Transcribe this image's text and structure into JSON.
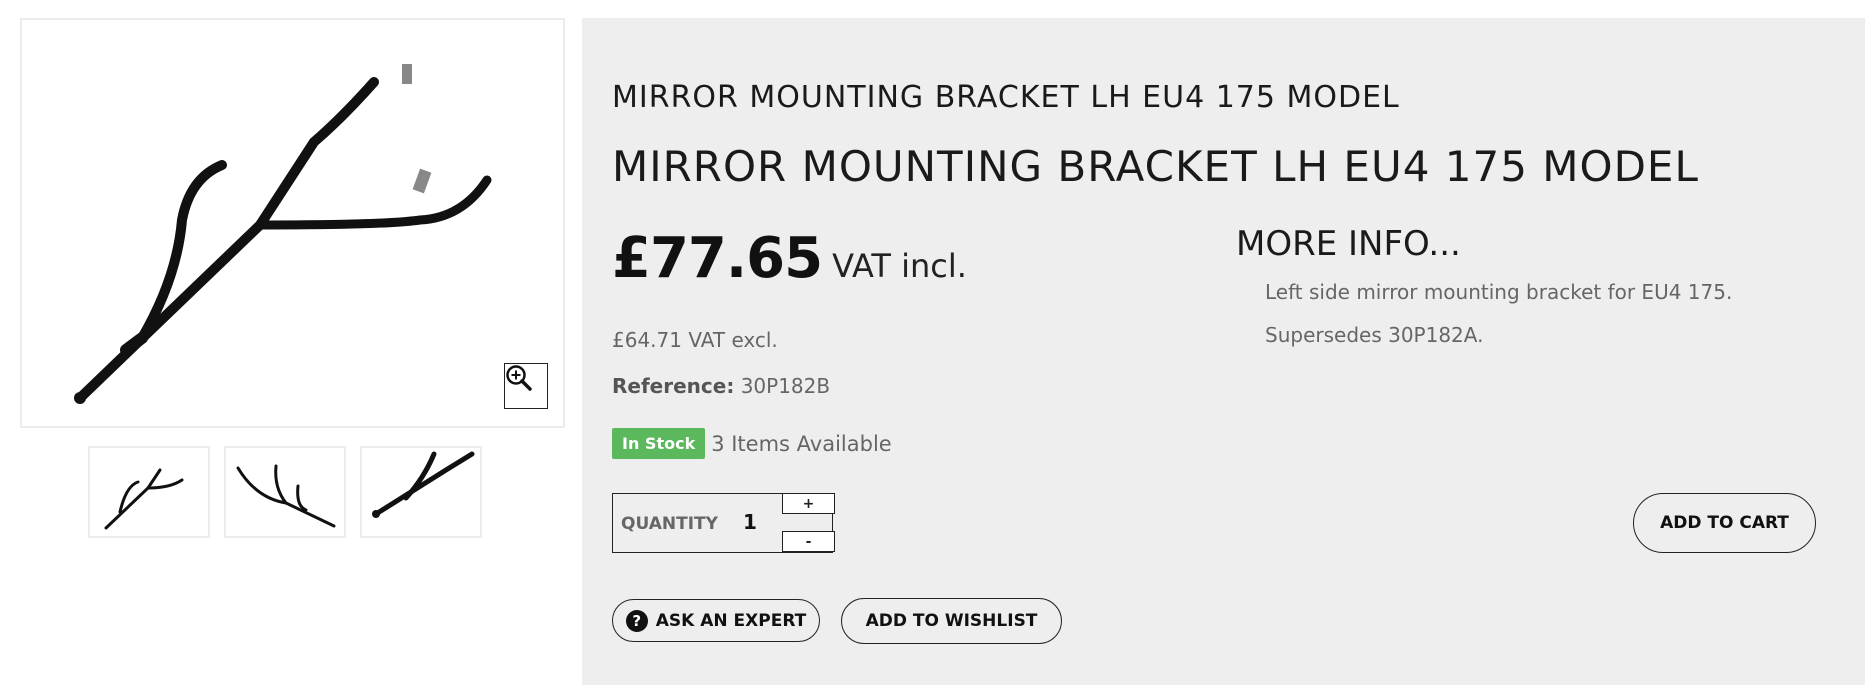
{
  "product": {
    "subtitle": "MIRROR MOUNTING BRACKET LH EU4 175 MODEL",
    "title": "MIRROR MOUNTING BRACKET LH EU4 175 MODEL",
    "price": "£77.65",
    "vat_incl_label": "VAT incl.",
    "vat_excl_text": "£64.71 VAT excl.",
    "reference_label": "Reference:",
    "reference_value": "30P182B",
    "stock_badge": "In Stock",
    "availability": "3 Items Available"
  },
  "quantity": {
    "label": "QUANTITY",
    "value": "1",
    "plus": "+",
    "minus": "-"
  },
  "buttons": {
    "add_to_cart": "ADD TO CART",
    "ask_expert": "ASK AN EXPERT",
    "ask_expert_icon_glyph": "?",
    "add_to_wishlist": "ADD TO WISHLIST"
  },
  "more_info": {
    "title": "MORE INFO...",
    "lines": [
      "Left side mirror mounting bracket for EU4 175.",
      "Supersedes 30P182A."
    ]
  },
  "gallery": {
    "thumbnail_count": 3,
    "zoom_icon": "zoom-in-icon"
  },
  "colors": {
    "panel_bg": "#eeeeee",
    "stock_green": "#5cb85c",
    "text_dark": "#111111",
    "text_muted": "#666666"
  }
}
